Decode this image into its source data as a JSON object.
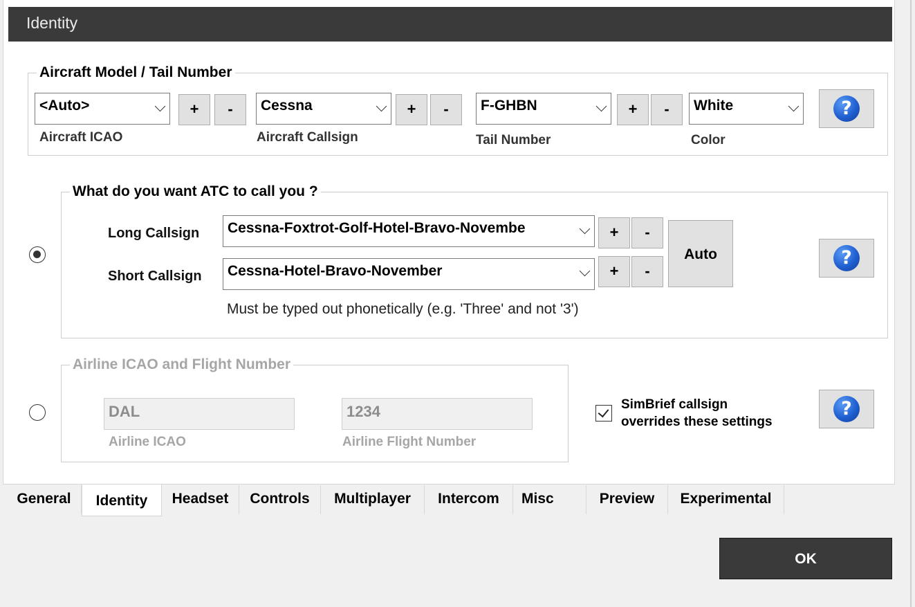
{
  "header": {
    "title": "Identity"
  },
  "aircraft_group": {
    "legend": "Aircraft Model / Tail Number",
    "icao": {
      "value": "<Auto>",
      "label": "Aircraft ICAO"
    },
    "callsign": {
      "value": "Cessna",
      "label": "Aircraft Callsign"
    },
    "tail": {
      "value": "F-GHBN",
      "label": "Tail Number"
    },
    "color": {
      "value": "White",
      "label": "Color"
    }
  },
  "atc_group": {
    "legend": "What do you want ATC to call you ?",
    "long": {
      "label": "Long Callsign",
      "value": "Cessna-Foxtrot-Golf-Hotel-Bravo-Novembe"
    },
    "short": {
      "label": "Short Callsign",
      "value": "Cessna-Hotel-Bravo-November"
    },
    "auto_label": "Auto",
    "hint": "Must be typed out phonetically (e.g. 'Three' and not '3')"
  },
  "airline_group": {
    "legend": "Airline ICAO and Flight Number",
    "icao": {
      "value": "DAL",
      "label": "Airline ICAO"
    },
    "flight": {
      "value": "1234",
      "label": "Airline Flight Number"
    }
  },
  "simbrief": {
    "label_line1": "SimBrief callsign",
    "label_line2": "overrides these settings",
    "checked": true
  },
  "buttons": {
    "plus": "+",
    "minus": "-",
    "help": "?",
    "ok": "OK"
  },
  "tabs": [
    {
      "label": "General"
    },
    {
      "label": "Identity",
      "active": true
    },
    {
      "label": "Headset"
    },
    {
      "label": "Controls"
    },
    {
      "label": "Multiplayer"
    },
    {
      "label": "Intercom"
    },
    {
      "label": "Misc"
    },
    {
      "label": "Preview"
    },
    {
      "label": "Experimental"
    }
  ],
  "colors": {
    "header_bg": "#3a3a3a",
    "help_blue": "#1f5fd1",
    "ok_bg": "#3a3a3a"
  }
}
